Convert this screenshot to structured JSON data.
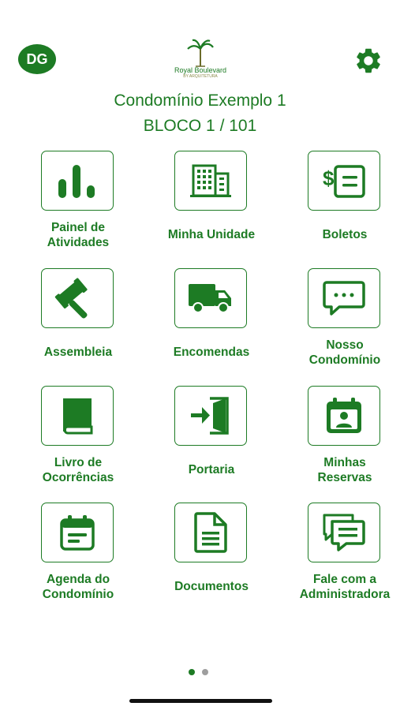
{
  "header": {
    "avatar_initials": "DG",
    "logo_name": "Royal Boulevard",
    "logo_tagline": "BY ARQUITETURA",
    "settings_icon": "gear-icon"
  },
  "condominium": {
    "name": "Condomínio Exemplo 1",
    "unit": "BLOCO 1 / 101"
  },
  "menu": [
    {
      "label": [
        "Painel de",
        "Atividades"
      ],
      "icon": "bar-chart-icon"
    },
    {
      "label": [
        "Minha Unidade"
      ],
      "icon": "building-icon"
    },
    {
      "label": [
        "Boletos"
      ],
      "icon": "bill-icon"
    },
    {
      "label": [
        "Assembleia"
      ],
      "icon": "gavel-icon"
    },
    {
      "label": [
        "Encomendas"
      ],
      "icon": "truck-icon"
    },
    {
      "label": [
        "Nosso",
        "Condomínio"
      ],
      "icon": "chat-bubble-icon"
    },
    {
      "label": [
        "Livro de",
        "Ocorrências"
      ],
      "icon": "book-icon"
    },
    {
      "label": [
        "Portaria"
      ],
      "icon": "door-enter-icon"
    },
    {
      "label": [
        "Minhas",
        "Reservas"
      ],
      "icon": "calendar-user-icon"
    },
    {
      "label": [
        "Agenda do",
        "Condomínio"
      ],
      "icon": "calendar-icon"
    },
    {
      "label": [
        "Documentos"
      ],
      "icon": "document-icon"
    },
    {
      "label": [
        "Fale com a",
        "Administradora"
      ],
      "icon": "messages-icon"
    }
  ],
  "pager": {
    "current_page": 1,
    "total_pages": 2
  },
  "colors": {
    "primary": "#1d7b24",
    "dot_inactive": "#9e9e9e"
  }
}
